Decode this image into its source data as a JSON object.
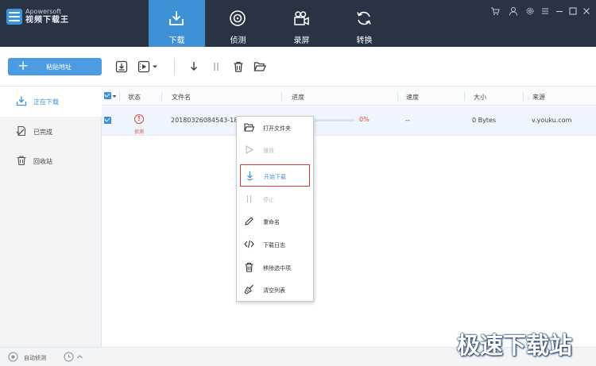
{
  "app": {
    "brand_name": "Apowersoft",
    "brand_title": "视频下载王"
  },
  "nav": {
    "tabs": [
      {
        "label": "下载",
        "icon": "download-tray-icon",
        "active": true
      },
      {
        "label": "侦测",
        "icon": "target-icon",
        "active": false
      },
      {
        "label": "录屏",
        "icon": "video-camera-icon",
        "active": false
      },
      {
        "label": "转换",
        "icon": "convert-arrows-icon",
        "active": false
      }
    ]
  },
  "window_controls": [
    "cart-icon",
    "user-icon",
    "settings-icon",
    "menu-icon",
    "minimize-icon",
    "maximize-icon",
    "close-icon"
  ],
  "toolbar": {
    "paste_label": "粘贴地址",
    "icons": [
      "import-icon",
      "video-format-icon",
      "start-download-icon",
      "pause-icon",
      "delete-icon",
      "open-folder-icon"
    ]
  },
  "sidebar": {
    "items": [
      {
        "label": "正在下载",
        "icon": "downloading-icon",
        "active": true
      },
      {
        "label": "已完成",
        "icon": "completed-icon",
        "active": false
      },
      {
        "label": "回收站",
        "icon": "trash-icon",
        "active": false
      }
    ]
  },
  "table": {
    "headers": {
      "status": "状态",
      "filename": "文件名",
      "progress": "进度",
      "speed": "速度",
      "size": "大小",
      "source": "来源"
    },
    "rows": [
      {
        "checked": true,
        "status_text": "侦测",
        "status_icon": "!",
        "filename": "20180326084543-1811",
        "progress_pct": "0%",
        "progress_fraction": 0,
        "speed": "--",
        "size": "0 Bytes",
        "source": "v.youku.com"
      }
    ]
  },
  "context_menu": {
    "items": [
      {
        "label": "打开文件夹",
        "icon": "open-folder-icon",
        "disabled": false,
        "highlight": false
      },
      {
        "label": "播放",
        "icon": "play-icon",
        "disabled": true,
        "highlight": false
      },
      {
        "label": "开始下载",
        "icon": "download-hand-icon",
        "disabled": false,
        "highlight": true
      },
      {
        "label": "停止",
        "icon": "stop-icon",
        "disabled": true,
        "highlight": false
      },
      {
        "label": "重命名",
        "icon": "pencil-icon",
        "disabled": false,
        "highlight": false
      },
      {
        "label": "下载日志",
        "icon": "code-icon",
        "disabled": false,
        "highlight": false
      },
      {
        "label": "移除选中项",
        "icon": "trash-icon",
        "disabled": false,
        "highlight": false
      },
      {
        "label": "清空列表",
        "icon": "broom-icon",
        "disabled": false,
        "highlight": false
      }
    ]
  },
  "statusbar": {
    "auto_detect_label": "自动侦测"
  },
  "watermark": "极速下载站",
  "colors": {
    "header_bg": "#2a3344",
    "accent": "#3f91d6",
    "alert": "#e14a3b",
    "highlight_border": "#d9363e"
  }
}
